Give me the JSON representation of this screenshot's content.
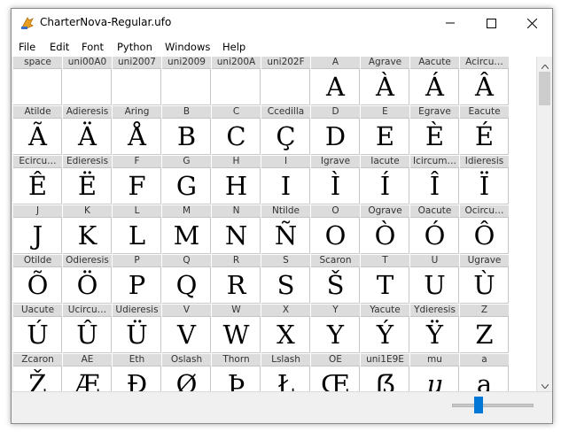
{
  "window": {
    "title": "CharterNova-Regular.ufo",
    "app_icon": "fontforge-app-icon",
    "buttons": [
      "minimize-icon",
      "maximize-icon",
      "close-icon"
    ]
  },
  "menu": [
    "File",
    "Edit",
    "Font",
    "Python",
    "Windows",
    "Help"
  ],
  "glyph_rows": [
    [
      {
        "name": "space",
        "char": ""
      },
      {
        "name": "uni00A0",
        "char": ""
      },
      {
        "name": "uni2007",
        "char": ""
      },
      {
        "name": "uni2009",
        "char": ""
      },
      {
        "name": "uni200A",
        "char": ""
      },
      {
        "name": "uni202F",
        "char": ""
      },
      {
        "name": "A",
        "char": "A"
      },
      {
        "name": "Agrave",
        "char": "À"
      },
      {
        "name": "Aacute",
        "char": "Á"
      },
      {
        "name": "Acircu…",
        "char": "Â"
      }
    ],
    [
      {
        "name": "Atilde",
        "char": "Ã"
      },
      {
        "name": "Adieresis",
        "char": "Ä"
      },
      {
        "name": "Aring",
        "char": "Å"
      },
      {
        "name": "B",
        "char": "B"
      },
      {
        "name": "C",
        "char": "C"
      },
      {
        "name": "Ccedilla",
        "char": "Ç"
      },
      {
        "name": "D",
        "char": "D"
      },
      {
        "name": "E",
        "char": "E"
      },
      {
        "name": "Egrave",
        "char": "È"
      },
      {
        "name": "Eacute",
        "char": "É"
      }
    ],
    [
      {
        "name": "Ecircu…",
        "char": "Ê"
      },
      {
        "name": "Edieresis",
        "char": "Ë"
      },
      {
        "name": "F",
        "char": "F"
      },
      {
        "name": "G",
        "char": "G"
      },
      {
        "name": "H",
        "char": "H"
      },
      {
        "name": "I",
        "char": "I"
      },
      {
        "name": "Igrave",
        "char": "Ì"
      },
      {
        "name": "Iacute",
        "char": "Í"
      },
      {
        "name": "Icircum…",
        "char": "Î"
      },
      {
        "name": "Idieresis",
        "char": "Ï"
      }
    ],
    [
      {
        "name": "J",
        "char": "J"
      },
      {
        "name": "K",
        "char": "K"
      },
      {
        "name": "L",
        "char": "L"
      },
      {
        "name": "M",
        "char": "M"
      },
      {
        "name": "N",
        "char": "N"
      },
      {
        "name": "Ntilde",
        "char": "Ñ"
      },
      {
        "name": "O",
        "char": "O"
      },
      {
        "name": "Ograve",
        "char": "Ò"
      },
      {
        "name": "Oacute",
        "char": "Ó"
      },
      {
        "name": "Ocircu…",
        "char": "Ô"
      }
    ],
    [
      {
        "name": "Otilde",
        "char": "Õ"
      },
      {
        "name": "Odieresis",
        "char": "Ö"
      },
      {
        "name": "P",
        "char": "P"
      },
      {
        "name": "Q",
        "char": "Q"
      },
      {
        "name": "R",
        "char": "R"
      },
      {
        "name": "S",
        "char": "S"
      },
      {
        "name": "Scaron",
        "char": "Š"
      },
      {
        "name": "T",
        "char": "T"
      },
      {
        "name": "U",
        "char": "U"
      },
      {
        "name": "Ugrave",
        "char": "Ù"
      }
    ],
    [
      {
        "name": "Uacute",
        "char": "Ú"
      },
      {
        "name": "Ucircu…",
        "char": "Û"
      },
      {
        "name": "Udieresis",
        "char": "Ü"
      },
      {
        "name": "V",
        "char": "V"
      },
      {
        "name": "W",
        "char": "W"
      },
      {
        "name": "X",
        "char": "X"
      },
      {
        "name": "Y",
        "char": "Y"
      },
      {
        "name": "Yacute",
        "char": "Ý"
      },
      {
        "name": "Ydieresis",
        "char": "Ÿ"
      },
      {
        "name": "Z",
        "char": "Z"
      }
    ],
    [
      {
        "name": "Zcaron",
        "char": "Ž"
      },
      {
        "name": "AE",
        "char": "Æ"
      },
      {
        "name": "Eth",
        "char": "Đ"
      },
      {
        "name": "Oslash",
        "char": "Ø"
      },
      {
        "name": "Thorn",
        "char": "Þ"
      },
      {
        "name": "Lslash",
        "char": "Ł"
      },
      {
        "name": "OE",
        "char": "Œ"
      },
      {
        "name": "uni1E9E",
        "char": "ẞ"
      },
      {
        "name": "mu",
        "char": "μ"
      },
      {
        "name": "a",
        "char": "a"
      }
    ]
  ],
  "scrollbar": {
    "up_icon": "scroll-up-arrow-icon",
    "down_icon": "scroll-down-arrow-icon"
  },
  "zoom_slider": {
    "accent": "#0078d7"
  }
}
